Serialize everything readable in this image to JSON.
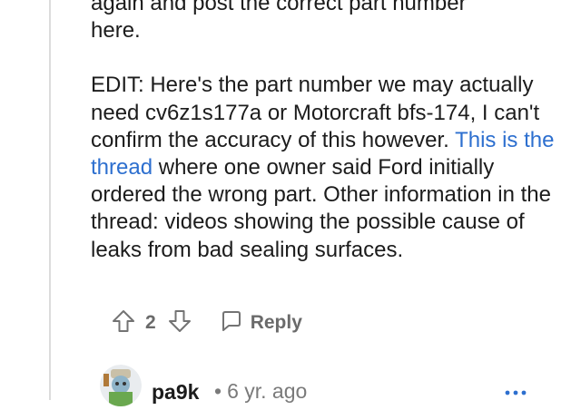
{
  "comment": {
    "line1": "again and post the correct part number",
    "line2": "here.",
    "edit_text_before": "EDIT: Here's the part number we may actually need cv6z1s177a or Motorcraft bfs-174, I can't confirm the accuracy of this however. ",
    "link_text": "This is the thread",
    "edit_text_after": " where one owner said Ford initially ordered the wrong part. Other information in the thread: videos showing the possible cause of leaks from bad sealing surfaces."
  },
  "actions": {
    "upvote_icon": "upvote-arrow-icon",
    "score": "2",
    "downvote_icon": "downvote-arrow-icon",
    "reply_icon": "chat-bubble-icon",
    "reply_label": "Reply"
  },
  "child_comment": {
    "username": "pa9k",
    "separator": "•",
    "age": "6 yr. ago",
    "more_icon": "more-options-icon"
  },
  "colors": {
    "link": "#2d6fcf",
    "text": "#1c1c1c",
    "muted": "#737373"
  }
}
